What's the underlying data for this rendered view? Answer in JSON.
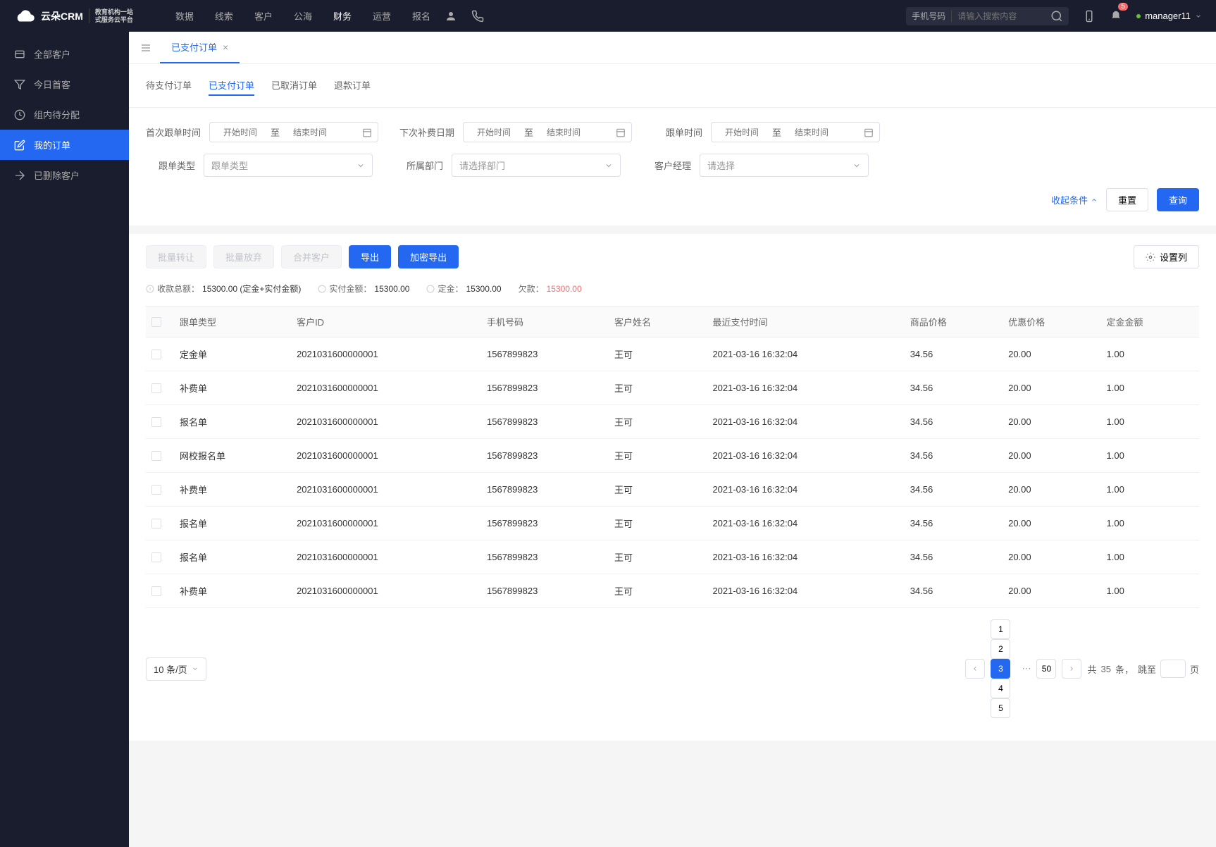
{
  "header": {
    "logo_main": "云朵CRM",
    "logo_sub1": "教育机构一站",
    "logo_sub2": "式服务云平台",
    "nav": [
      {
        "label": "数据",
        "active": false
      },
      {
        "label": "线索",
        "active": false
      },
      {
        "label": "客户",
        "active": false
      },
      {
        "label": "公海",
        "active": false
      },
      {
        "label": "财务",
        "active": true
      },
      {
        "label": "运营",
        "active": false
      },
      {
        "label": "报名",
        "active": false
      }
    ],
    "search_label": "手机号码",
    "search_placeholder": "请输入搜索内容",
    "notification_count": "5",
    "username": "manager11"
  },
  "sidebar": {
    "items": [
      {
        "label": "全部客户",
        "icon": "card-icon"
      },
      {
        "label": "今日首客",
        "icon": "filter-icon"
      },
      {
        "label": "组内待分配",
        "icon": "clock-icon"
      },
      {
        "label": "我的订单",
        "icon": "edit-icon",
        "active": true
      },
      {
        "label": "已删除客户",
        "icon": "arrow-icon"
      }
    ]
  },
  "tabs_bar": {
    "tab_label": "已支付订单"
  },
  "sub_tabs": [
    {
      "label": "待支付订单",
      "active": false
    },
    {
      "label": "已支付订单",
      "active": true
    },
    {
      "label": "已取消订单",
      "active": false
    },
    {
      "label": "退款订单",
      "active": false
    }
  ],
  "filters": {
    "first_follow_time_label": "首次跟单时间",
    "next_pay_date_label": "下次补费日期",
    "follow_time_label": "跟单时间",
    "follow_type_label": "跟单类型",
    "follow_type_placeholder": "跟单类型",
    "department_label": "所属部门",
    "department_placeholder": "请选择部门",
    "account_manager_label": "客户经理",
    "account_manager_placeholder": "请选择",
    "start_placeholder": "开始时间",
    "end_placeholder": "结束时间",
    "date_sep": "至",
    "collapse_label": "收起条件",
    "reset_label": "重置",
    "query_label": "查询"
  },
  "toolbar": {
    "batch_transfer": "批量转让",
    "batch_abandon": "批量放弃",
    "merge_customer": "合并客户",
    "export": "导出",
    "encrypt_export": "加密导出",
    "settings_col": "设置列"
  },
  "summary": {
    "total_label": "收款总额：",
    "total_value": "15300.00 (定金+实付金额)",
    "paid_label": "实付金额：",
    "paid_value": "15300.00",
    "deposit_label": "定金：",
    "deposit_value": "15300.00",
    "owed_label": "欠款：",
    "owed_value": "15300.00"
  },
  "table": {
    "headers": [
      "跟单类型",
      "客户ID",
      "手机号码",
      "客户姓名",
      "最近支付时间",
      "商品价格",
      "优惠价格",
      "定金金额"
    ],
    "rows": [
      {
        "type": "定金单",
        "id": "2021031600000001",
        "phone": "1567899823",
        "name": "王可",
        "time": "2021-03-16 16:32:04",
        "price": "34.56",
        "discount": "20.00",
        "deposit": "1.00"
      },
      {
        "type": "补费单",
        "id": "2021031600000001",
        "phone": "1567899823",
        "name": "王可",
        "time": "2021-03-16 16:32:04",
        "price": "34.56",
        "discount": "20.00",
        "deposit": "1.00"
      },
      {
        "type": "报名单",
        "id": "2021031600000001",
        "phone": "1567899823",
        "name": "王可",
        "time": "2021-03-16 16:32:04",
        "price": "34.56",
        "discount": "20.00",
        "deposit": "1.00"
      },
      {
        "type": "网校报名单",
        "id": "2021031600000001",
        "phone": "1567899823",
        "name": "王可",
        "time": "2021-03-16 16:32:04",
        "price": "34.56",
        "discount": "20.00",
        "deposit": "1.00"
      },
      {
        "type": "补费单",
        "id": "2021031600000001",
        "phone": "1567899823",
        "name": "王可",
        "time": "2021-03-16 16:32:04",
        "price": "34.56",
        "discount": "20.00",
        "deposit": "1.00"
      },
      {
        "type": "报名单",
        "id": "2021031600000001",
        "phone": "1567899823",
        "name": "王可",
        "time": "2021-03-16 16:32:04",
        "price": "34.56",
        "discount": "20.00",
        "deposit": "1.00"
      },
      {
        "type": "报名单",
        "id": "2021031600000001",
        "phone": "1567899823",
        "name": "王可",
        "time": "2021-03-16 16:32:04",
        "price": "34.56",
        "discount": "20.00",
        "deposit": "1.00"
      },
      {
        "type": "补费单",
        "id": "2021031600000001",
        "phone": "1567899823",
        "name": "王可",
        "time": "2021-03-16 16:32:04",
        "price": "34.56",
        "discount": "20.00",
        "deposit": "1.00"
      }
    ]
  },
  "pagination": {
    "page_size_label": "10 条/页",
    "pages": [
      "1",
      "2",
      "3",
      "4",
      "5"
    ],
    "active_page": "3",
    "last_page": "50",
    "total_prefix": "共",
    "total_count": "35",
    "total_suffix": "条，",
    "jump_label": "跳至",
    "page_suffix": "页"
  }
}
